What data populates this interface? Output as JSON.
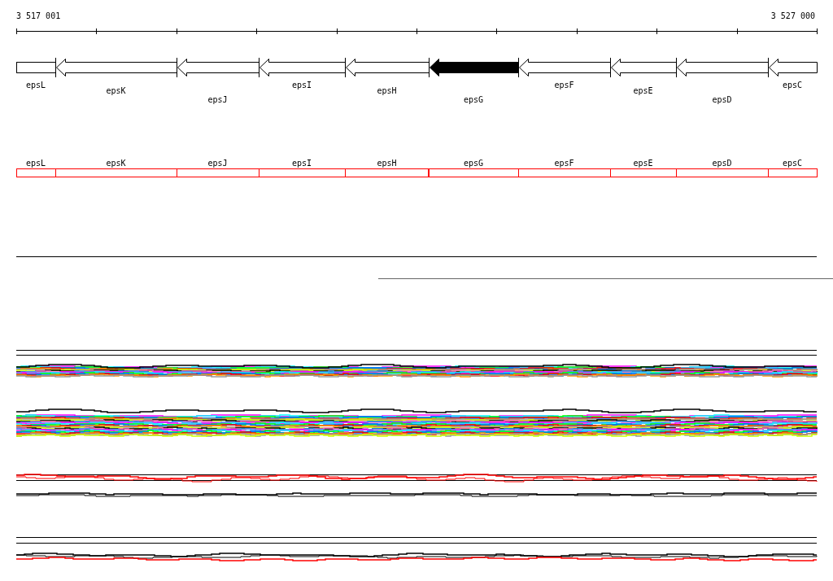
{
  "ruler": {
    "start_label": "3 517 001",
    "end_label": "3 527 000"
  },
  "genes": [
    {
      "label": "epsL",
      "kind": "box",
      "selected": false
    },
    {
      "label": "epsK",
      "kind": "arrow",
      "selected": false
    },
    {
      "label": "epsJ",
      "kind": "arrow",
      "selected": false
    },
    {
      "label": "epsI",
      "kind": "arrow",
      "selected": false
    },
    {
      "label": "epsH",
      "kind": "arrow",
      "selected": false
    },
    {
      "label": "epsG",
      "kind": "arrow",
      "selected": true
    },
    {
      "label": "epsF",
      "kind": "arrow",
      "selected": false
    },
    {
      "label": "epsE",
      "kind": "arrow",
      "selected": false
    },
    {
      "label": "epsD",
      "kind": "arrow",
      "selected": false
    },
    {
      "label": "epsC",
      "kind": "arrow",
      "selected": false
    }
  ],
  "feature_track": {
    "labels": [
      "epsL",
      "epsK",
      "epsJ",
      "epsI",
      "epsH",
      "epsG",
      "epsF",
      "epsE",
      "epsD",
      "epsC"
    ]
  }
}
